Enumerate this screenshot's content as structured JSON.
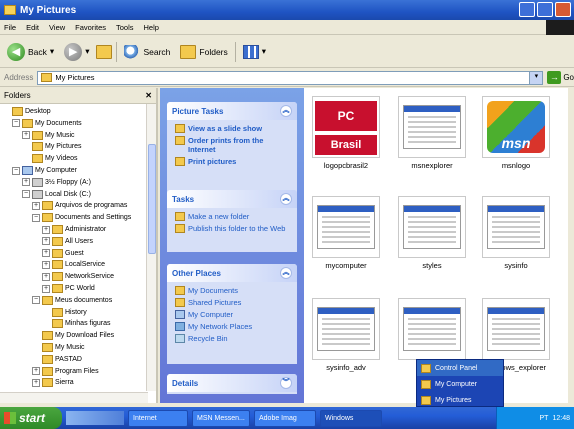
{
  "window": {
    "title": "My Pictures"
  },
  "menu": [
    "File",
    "Edit",
    "View",
    "Favorites",
    "Tools",
    "Help"
  ],
  "toolbar": {
    "back": "Back",
    "search": "Search",
    "folders": "Folders"
  },
  "address": {
    "label": "Address",
    "value": "My Pictures",
    "go": "Go"
  },
  "folders_pane": {
    "title": "Folders",
    "tree": [
      {
        "label": "Desktop",
        "level": 0,
        "exp": "",
        "icon": "desktop"
      },
      {
        "label": "My Documents",
        "level": 1,
        "exp": "−",
        "icon": "folder"
      },
      {
        "label": "My Music",
        "level": 2,
        "exp": "+",
        "icon": "folder"
      },
      {
        "label": "My Pictures",
        "level": 2,
        "exp": "",
        "icon": "folder"
      },
      {
        "label": "My Videos",
        "level": 2,
        "exp": "",
        "icon": "folder"
      },
      {
        "label": "My Computer",
        "level": 1,
        "exp": "−",
        "icon": "pc"
      },
      {
        "label": "3½ Floppy (A:)",
        "level": 2,
        "exp": "+",
        "icon": "drive"
      },
      {
        "label": "Local Disk (C:)",
        "level": 2,
        "exp": "−",
        "icon": "drive"
      },
      {
        "label": "Arquivos de programas",
        "level": 3,
        "exp": "+",
        "icon": "folder"
      },
      {
        "label": "Documents and Settings",
        "level": 3,
        "exp": "−",
        "icon": "folder"
      },
      {
        "label": "Administrator",
        "level": 4,
        "exp": "+",
        "icon": "folder"
      },
      {
        "label": "All Users",
        "level": 4,
        "exp": "+",
        "icon": "folder"
      },
      {
        "label": "Guest",
        "level": 4,
        "exp": "+",
        "icon": "folder"
      },
      {
        "label": "LocalService",
        "level": 4,
        "exp": "+",
        "icon": "folder"
      },
      {
        "label": "NetworkService",
        "level": 4,
        "exp": "+",
        "icon": "folder"
      },
      {
        "label": "PC World",
        "level": 4,
        "exp": "+",
        "icon": "folder"
      },
      {
        "label": "Meus documentos",
        "level": 3,
        "exp": "−",
        "icon": "folder"
      },
      {
        "label": "History",
        "level": 4,
        "exp": "",
        "icon": "folder"
      },
      {
        "label": "Minhas figuras",
        "level": 4,
        "exp": "",
        "icon": "folder"
      },
      {
        "label": "My Download Files",
        "level": 3,
        "exp": "",
        "icon": "folder"
      },
      {
        "label": "My Music",
        "level": 3,
        "exp": "",
        "icon": "folder"
      },
      {
        "label": "PASTAD",
        "level": 3,
        "exp": "",
        "icon": "folder"
      },
      {
        "label": "Program Files",
        "level": 3,
        "exp": "+",
        "icon": "folder"
      },
      {
        "label": "Sierra",
        "level": 3,
        "exp": "+",
        "icon": "folder"
      }
    ]
  },
  "picture_tasks": {
    "title": "Picture Tasks",
    "items": [
      "View as a slide show",
      "Order prints from the Internet",
      "Print pictures"
    ]
  },
  "tasks": {
    "title": "Tasks",
    "items": [
      "Make a new folder",
      "Publish this folder to the Web"
    ]
  },
  "other_places": {
    "title": "Other Places",
    "items": [
      "My Documents",
      "Shared Pictures",
      "My Computer",
      "My Network Places",
      "Recycle Bin"
    ]
  },
  "details": {
    "title": "Details"
  },
  "files": [
    {
      "name": "logopcbrasil2",
      "kind": "pcworld",
      "logo_top": "PC WORLD",
      "logo_bottom": "Brasil"
    },
    {
      "name": "msnexplorer",
      "kind": "shot"
    },
    {
      "name": "msnlogo",
      "kind": "msn",
      "logo": "msn"
    },
    {
      "name": "mycomputer",
      "kind": "shot"
    },
    {
      "name": "styles",
      "kind": "shot"
    },
    {
      "name": "sysinfo",
      "kind": "shot"
    },
    {
      "name": "sysinfo_adv",
      "kind": "shot"
    },
    {
      "name": "",
      "kind": "shot"
    },
    {
      "name": "windows_explorer",
      "kind": "shot"
    }
  ],
  "taskbar": {
    "start": "start",
    "buttons": [
      "Internet",
      "MSN Messen...",
      "Adobe Imag",
      "Windows"
    ],
    "clock": "12:48",
    "lang": "PT"
  },
  "popup": {
    "items": [
      "Control Panel",
      "My Computer",
      "My Pictures"
    ]
  }
}
